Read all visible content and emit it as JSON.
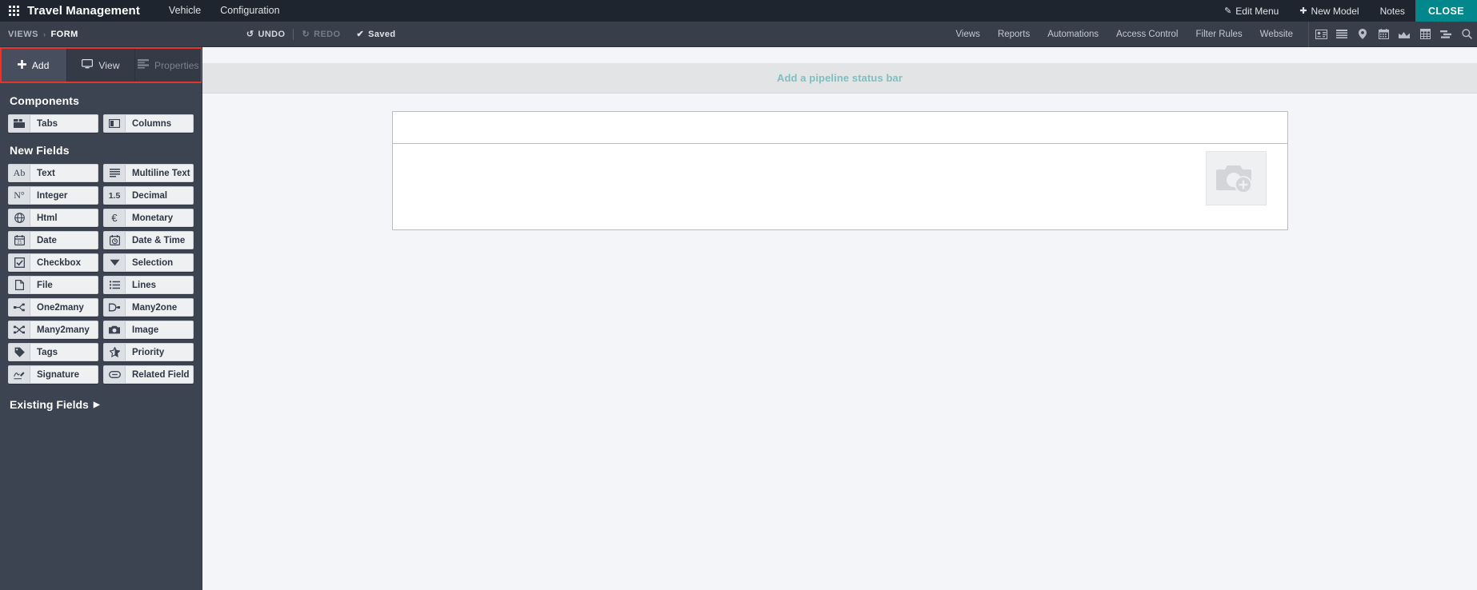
{
  "topbar": {
    "apps_icon": "apps-grid-icon",
    "app_title": "Travel Management",
    "menu": [
      {
        "label": "Vehicle"
      },
      {
        "label": "Configuration"
      }
    ],
    "right": [
      {
        "label": "Edit Menu",
        "glyph": "✎",
        "icon_name": "pencil-icon"
      },
      {
        "label": "New Model",
        "glyph": "✚",
        "icon_name": "plus-icon"
      },
      {
        "label": "Notes",
        "glyph": "",
        "icon_name": ""
      }
    ],
    "close_label": "CLOSE",
    "close_color": "#01878c"
  },
  "subheader": {
    "breadcrumb": {
      "root": "VIEWS",
      "separator": "›",
      "current": "FORM"
    },
    "undo_label": "UNDO",
    "redo_label": "REDO",
    "saved_label": "Saved",
    "undo_glyph": "↺",
    "redo_glyph": "↻",
    "saved_glyph": "✔",
    "links": [
      {
        "label": "Views"
      },
      {
        "label": "Reports"
      },
      {
        "label": "Automations"
      },
      {
        "label": "Access Control"
      },
      {
        "label": "Filter Rules"
      },
      {
        "label": "Website"
      }
    ],
    "view_icons": [
      {
        "name": "kanban-card-icon"
      },
      {
        "name": "list-icon"
      },
      {
        "name": "map-pin-icon"
      },
      {
        "name": "calendar-icon"
      },
      {
        "name": "graph-icon"
      },
      {
        "name": "pivot-table-icon"
      },
      {
        "name": "gantt-icon"
      },
      {
        "name": "search-icon"
      }
    ]
  },
  "sidebar": {
    "tabs": [
      {
        "label": "Add",
        "icon": "plus-icon",
        "active": true,
        "disabled": false
      },
      {
        "label": "View",
        "icon": "monitor-icon",
        "active": false,
        "disabled": false
      },
      {
        "label": "Properties",
        "icon": "properties-icon",
        "active": false,
        "disabled": true
      }
    ],
    "highlight_color": "#e8352c",
    "components_title": "Components",
    "components": [
      {
        "label": "Tabs",
        "icon": "tabs-icon"
      },
      {
        "label": "Columns",
        "icon": "columns-icon"
      }
    ],
    "new_fields_title": "New Fields",
    "new_fields": [
      {
        "label": "Text",
        "icon": "text-ab-icon"
      },
      {
        "label": "Multiline Text",
        "icon": "multiline-text-icon"
      },
      {
        "label": "Integer",
        "icon": "integer-icon"
      },
      {
        "label": "Decimal",
        "icon": "decimal-icon"
      },
      {
        "label": "Html",
        "icon": "globe-icon"
      },
      {
        "label": "Monetary",
        "icon": "euro-icon"
      },
      {
        "label": "Date",
        "icon": "calendar-icon"
      },
      {
        "label": "Date & Time",
        "icon": "clock-calendar-icon"
      },
      {
        "label": "Checkbox",
        "icon": "checkbox-icon"
      },
      {
        "label": "Selection",
        "icon": "caret-down-icon"
      },
      {
        "label": "File",
        "icon": "file-icon"
      },
      {
        "label": "Lines",
        "icon": "lines-list-icon"
      },
      {
        "label": "One2many",
        "icon": "one2many-icon"
      },
      {
        "label": "Many2one",
        "icon": "many2one-icon"
      },
      {
        "label": "Many2many",
        "icon": "many2many-icon"
      },
      {
        "label": "Image",
        "icon": "camera-icon"
      },
      {
        "label": "Tags",
        "icon": "tag-icon"
      },
      {
        "label": "Priority",
        "icon": "star-icon"
      },
      {
        "label": "Signature",
        "icon": "signature-icon"
      },
      {
        "label": "Related Field",
        "icon": "link-icon"
      }
    ],
    "existing_fields_label": "Existing Fields",
    "existing_fields_caret": "▶"
  },
  "canvas": {
    "pipeline_label": "Add a pipeline status bar",
    "pipeline_color": "#7fbfbf",
    "image_placeholder_icon": "camera-plus-icon"
  }
}
